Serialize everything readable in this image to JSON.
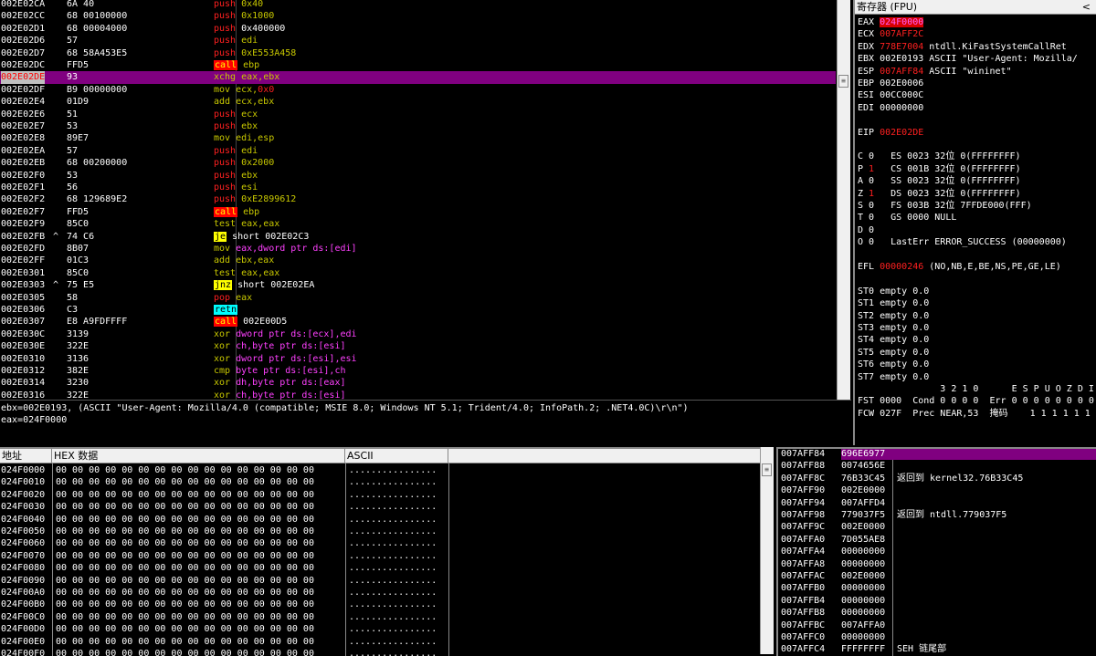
{
  "disasm": {
    "rows": [
      {
        "addr": "002E02CA",
        "hex": "6A 40",
        "cmd": [
          {
            "t": "push",
            "c": "red"
          },
          {
            "t": " 0x40",
            "c": "ylw"
          }
        ]
      },
      {
        "addr": "002E02CC",
        "hex": "68 00100000",
        "cmd": [
          {
            "t": "push",
            "c": "red"
          },
          {
            "t": " 0x1000",
            "c": "ylw"
          }
        ]
      },
      {
        "addr": "002E02D1",
        "hex": "68 00004000",
        "cmd": [
          {
            "t": "push",
            "c": "red"
          },
          {
            "t": " 0x400000",
            "c": "wht"
          }
        ]
      },
      {
        "addr": "002E02D6",
        "hex": "57",
        "cmd": [
          {
            "t": "push",
            "c": "red"
          },
          {
            "t": " edi",
            "c": "ylw"
          }
        ]
      },
      {
        "addr": "002E02D7",
        "hex": "68 58A453E5",
        "cmd": [
          {
            "t": "push",
            "c": "red"
          },
          {
            "t": " 0xE553A458",
            "c": "ylw"
          }
        ]
      },
      {
        "addr": "002E02DC",
        "hex": "FFD5",
        "cmd": [
          {
            "t": "call",
            "c": "call"
          },
          {
            "t": " ebp",
            "c": "ylw"
          }
        ]
      },
      {
        "addr": "002E02DE",
        "hex": "93",
        "sel": true,
        "cmd": [
          {
            "t": "xchg",
            "c": "ylw"
          },
          {
            "t": " eax,ebx",
            "c": "ylw"
          }
        ]
      },
      {
        "addr": "002E02DF",
        "hex": "B9 00000000",
        "cmd": [
          {
            "t": "mov",
            "c": "ylw"
          },
          {
            "t": " ecx,",
            "c": "ylw"
          },
          {
            "t": "0x0",
            "c": "red"
          }
        ]
      },
      {
        "addr": "002E02E4",
        "hex": "01D9",
        "cmd": [
          {
            "t": "add",
            "c": "ylw"
          },
          {
            "t": " ecx,ebx",
            "c": "ylw"
          }
        ]
      },
      {
        "addr": "002E02E6",
        "hex": "51",
        "cmd": [
          {
            "t": "push",
            "c": "red"
          },
          {
            "t": " ecx",
            "c": "ylw"
          }
        ]
      },
      {
        "addr": "002E02E7",
        "hex": "53",
        "cmd": [
          {
            "t": "push",
            "c": "red"
          },
          {
            "t": " ebx",
            "c": "ylw"
          }
        ]
      },
      {
        "addr": "002E02E8",
        "hex": "89E7",
        "cmd": [
          {
            "t": "mov",
            "c": "ylw"
          },
          {
            "t": " edi,esp",
            "c": "ylw"
          }
        ]
      },
      {
        "addr": "002E02EA",
        "hex": "57",
        "cmd": [
          {
            "t": "push",
            "c": "red"
          },
          {
            "t": " edi",
            "c": "ylw"
          }
        ]
      },
      {
        "addr": "002E02EB",
        "hex": "68 00200000",
        "cmd": [
          {
            "t": "push",
            "c": "red"
          },
          {
            "t": " 0x2000",
            "c": "ylw"
          }
        ]
      },
      {
        "addr": "002E02F0",
        "hex": "53",
        "cmd": [
          {
            "t": "push",
            "c": "red"
          },
          {
            "t": " ebx",
            "c": "ylw"
          }
        ]
      },
      {
        "addr": "002E02F1",
        "hex": "56",
        "cmd": [
          {
            "t": "push",
            "c": "red"
          },
          {
            "t": " esi",
            "c": "ylw"
          }
        ]
      },
      {
        "addr": "002E02F2",
        "hex": "68 129689E2",
        "cmd": [
          {
            "t": "push",
            "c": "red"
          },
          {
            "t": " 0xE2899612",
            "c": "ylw"
          }
        ]
      },
      {
        "addr": "002E02F7",
        "hex": "FFD5",
        "cmd": [
          {
            "t": "call",
            "c": "call"
          },
          {
            "t": " ebp",
            "c": "ylw"
          }
        ]
      },
      {
        "addr": "002E02F9",
        "hex": "85C0",
        "cmd": [
          {
            "t": "test",
            "c": "ylw"
          },
          {
            "t": " eax,eax",
            "c": "ylw"
          }
        ]
      },
      {
        "addr": "002E02FB",
        "mark": "^",
        "hex": "74 C6",
        "cmd": [
          {
            "t": "je",
            "c": "jmp"
          },
          {
            "t": " short 002E02C3",
            "c": "wht"
          }
        ]
      },
      {
        "addr": "002E02FD",
        "hex": "8B07",
        "cmd": [
          {
            "t": "mov",
            "c": "ylw"
          },
          {
            "t": " eax,dword ptr ds:[edi]",
            "c": "mag"
          }
        ]
      },
      {
        "addr": "002E02FF",
        "hex": "01C3",
        "cmd": [
          {
            "t": "add",
            "c": "ylw"
          },
          {
            "t": " ebx,eax",
            "c": "ylw"
          }
        ]
      },
      {
        "addr": "002E0301",
        "hex": "85C0",
        "cmd": [
          {
            "t": "test",
            "c": "ylw"
          },
          {
            "t": " eax,eax",
            "c": "ylw"
          }
        ]
      },
      {
        "addr": "002E0303",
        "mark": "^",
        "hex": "75 E5",
        "cmd": [
          {
            "t": "jnz",
            "c": "jmp"
          },
          {
            "t": " short 002E02EA",
            "c": "wht"
          }
        ]
      },
      {
        "addr": "002E0305",
        "hex": "58",
        "cmd": [
          {
            "t": "pop",
            "c": "red"
          },
          {
            "t": " eax",
            "c": "ylw"
          }
        ]
      },
      {
        "addr": "002E0306",
        "hex": "C3",
        "cmd": [
          {
            "t": "retn",
            "c": "retn"
          }
        ]
      },
      {
        "addr": "002E0307",
        "hex": "E8 A9FDFFFF",
        "cmd": [
          {
            "t": "call",
            "c": "call"
          },
          {
            "t": " 002E00D5",
            "c": "wht"
          }
        ]
      },
      {
        "addr": "002E030C",
        "hex": "3139",
        "cmd": [
          {
            "t": "xor",
            "c": "ylw"
          },
          {
            "t": " dword ptr ds:[ecx],edi",
            "c": "mag"
          }
        ]
      },
      {
        "addr": "002E030E",
        "hex": "322E",
        "cmd": [
          {
            "t": "xor",
            "c": "ylw"
          },
          {
            "t": " ch,byte ptr ds:[esi]",
            "c": "mag"
          }
        ]
      },
      {
        "addr": "002E0310",
        "hex": "3136",
        "cmd": [
          {
            "t": "xor",
            "c": "ylw"
          },
          {
            "t": " dword ptr ds:[esi],esi",
            "c": "mag"
          }
        ]
      },
      {
        "addr": "002E0312",
        "hex": "382E",
        "cmd": [
          {
            "t": "cmp",
            "c": "ylw"
          },
          {
            "t": " byte ptr ds:[esi],ch",
            "c": "mag"
          }
        ]
      },
      {
        "addr": "002E0314",
        "hex": "3230",
        "cmd": [
          {
            "t": "xor",
            "c": "ylw"
          },
          {
            "t": " dh,byte ptr ds:[eax]",
            "c": "mag"
          }
        ]
      },
      {
        "addr": "002E0316",
        "hex": "322E",
        "cmd": [
          {
            "t": "xor",
            "c": "ylw"
          },
          {
            "t": " ch,byte ptr ds:[esi]",
            "c": "mag"
          }
        ]
      }
    ]
  },
  "info": {
    "line1": "ebx=002E0193, (ASCII \"User-Agent: Mozilla/4.0 (compatible; MSIE 8.0; Windows NT 5.1; Trident/4.0; InfoPath.2; .NET4.0C)\\r\\n\")",
    "line2": "eax=024F0000"
  },
  "registers": {
    "title": "寄存器 (FPU)",
    "lines": [
      [
        {
          "t": "EAX "
        },
        {
          "t": "024F0000",
          "c": "redbg"
        }
      ],
      [
        {
          "t": "ECX "
        },
        {
          "t": "007AFF2C",
          "c": "red"
        }
      ],
      [
        {
          "t": "EDX "
        },
        {
          "t": "778E7004",
          "c": "red"
        },
        {
          "t": " ntdll.KiFastSystemCallRet"
        }
      ],
      [
        {
          "t": "EBX 002E0193 ASCII \"User-Agent: Mozilla/"
        }
      ],
      [
        {
          "t": "ESP "
        },
        {
          "t": "007AFF84",
          "c": "red"
        },
        {
          "t": " ASCII \"wininet\""
        }
      ],
      [
        {
          "t": "EBP 002E0006"
        }
      ],
      [
        {
          "t": "ESI 00CC000C"
        }
      ],
      [
        {
          "t": "EDI 00000000"
        }
      ],
      [
        {
          "t": ""
        }
      ],
      [
        {
          "t": "EIP "
        },
        {
          "t": "002E02DE",
          "c": "red"
        }
      ],
      [
        {
          "t": ""
        }
      ],
      [
        {
          "t": "C 0   ES 0023 32位 0(FFFFFFFF)"
        }
      ],
      [
        {
          "t": "P "
        },
        {
          "t": "1",
          "c": "red"
        },
        {
          "t": "   CS 001B 32位 0(FFFFFFFF)"
        }
      ],
      [
        {
          "t": "A 0   SS 0023 32位 0(FFFFFFFF)"
        }
      ],
      [
        {
          "t": "Z "
        },
        {
          "t": "1",
          "c": "red"
        },
        {
          "t": "   DS 0023 32位 0(FFFFFFFF)"
        }
      ],
      [
        {
          "t": "S 0   FS 003B 32位 7FFDE000(FFF)"
        }
      ],
      [
        {
          "t": "T 0   GS 0000 NULL"
        }
      ],
      [
        {
          "t": "D 0"
        }
      ],
      [
        {
          "t": "O 0   LastErr ERROR_SUCCESS (00000000)"
        }
      ],
      [
        {
          "t": ""
        }
      ],
      [
        {
          "t": "EFL "
        },
        {
          "t": "00000246",
          "c": "red"
        },
        {
          "t": " (NO,NB,E,BE,NS,PE,GE,LE)"
        }
      ],
      [
        {
          "t": ""
        }
      ],
      [
        {
          "t": "ST0 empty 0.0"
        }
      ],
      [
        {
          "t": "ST1 empty 0.0"
        }
      ],
      [
        {
          "t": "ST2 empty 0.0"
        }
      ],
      [
        {
          "t": "ST3 empty 0.0"
        }
      ],
      [
        {
          "t": "ST4 empty 0.0"
        }
      ],
      [
        {
          "t": "ST5 empty 0.0"
        }
      ],
      [
        {
          "t": "ST6 empty 0.0"
        }
      ],
      [
        {
          "t": "ST7 empty 0.0"
        }
      ],
      [
        {
          "t": "               3 2 1 0      E S P U O Z D I"
        }
      ],
      [
        {
          "t": "FST 0000  Cond 0 0 0 0  Err 0 0 0 0 0 0 0 0"
        }
      ],
      [
        {
          "t": "FCW 027F  Prec NEAR,53  掩码    1 1 1 1 1 1"
        }
      ]
    ]
  },
  "dump": {
    "header_addr": "地址",
    "header_hex": "HEX 数据",
    "header_ascii": "ASCII",
    "addrs": [
      "024F0000",
      "024F0010",
      "024F0020",
      "024F0030",
      "024F0040",
      "024F0050",
      "024F0060",
      "024F0070",
      "024F0080",
      "024F0090",
      "024F00A0",
      "024F00B0",
      "024F00C0",
      "024F00D0",
      "024F00E0",
      "024F00F0"
    ],
    "hex_line": "00 00 00 00 00 00 00 00 00 00 00 00 00 00 00 00",
    "ascii_line": "................"
  },
  "stack": {
    "rows": [
      {
        "addr": "007AFF84",
        "val": "696E6977",
        "cmt": "",
        "sel": true
      },
      {
        "addr": "007AFF88",
        "val": "0074656E",
        "cmt": ""
      },
      {
        "addr": "007AFF8C",
        "val": "76B33C45",
        "cmt": "返回到 kernel32.76B33C45"
      },
      {
        "addr": "007AFF90",
        "val": "002E0000",
        "cmt": ""
      },
      {
        "addr": "007AFF94",
        "val": "007AFFD4",
        "cmt": ""
      },
      {
        "addr": "007AFF98",
        "val": "779037F5",
        "cmt": "返回到 ntdll.779037F5"
      },
      {
        "addr": "007AFF9C",
        "val": "002E0000",
        "cmt": ""
      },
      {
        "addr": "007AFFA0",
        "val": "7D055AE8",
        "cmt": ""
      },
      {
        "addr": "007AFFA4",
        "val": "00000000",
        "cmt": ""
      },
      {
        "addr": "007AFFA8",
        "val": "00000000",
        "cmt": ""
      },
      {
        "addr": "007AFFAC",
        "val": "002E0000",
        "cmt": ""
      },
      {
        "addr": "007AFFB0",
        "val": "00000000",
        "cmt": ""
      },
      {
        "addr": "007AFFB4",
        "val": "00000000",
        "cmt": ""
      },
      {
        "addr": "007AFFB8",
        "val": "00000000",
        "cmt": ""
      },
      {
        "addr": "007AFFBC",
        "val": "007AFFA0",
        "cmt": ""
      },
      {
        "addr": "007AFFC0",
        "val": "00000000",
        "cmt": ""
      },
      {
        "addr": "007AFFC4",
        "val": "FFFFFFFF",
        "cmt": "SEH 链尾部"
      }
    ]
  }
}
